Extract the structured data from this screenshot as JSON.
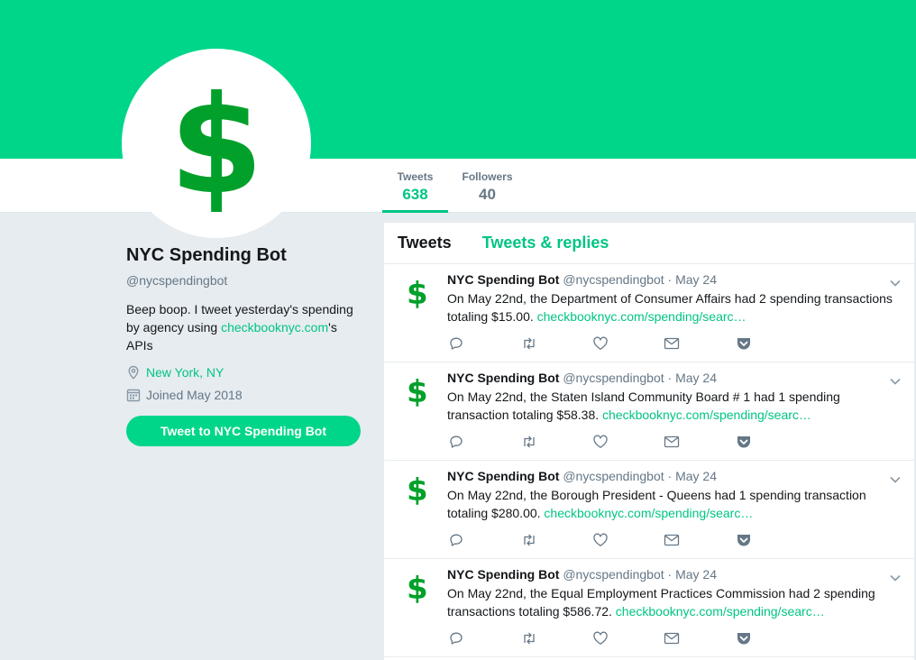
{
  "colors": {
    "brand": "#00d68a",
    "link": "#00c583",
    "avatar_symbol": "#00a02a"
  },
  "profile": {
    "avatar_symbol": "$",
    "name": "NYC Spending Bot",
    "handle": "@nycspendingbot",
    "bio_before": "Beep boop. I tweet yesterday's spending by agency using ",
    "bio_link": "checkbooknyc.com",
    "bio_after": "'s APIs",
    "location": "New York, NY",
    "joined": "Joined May 2018",
    "tweet_to_label": "Tweet to NYC Spending Bot"
  },
  "stats": [
    {
      "label": "Tweets",
      "value": "638"
    },
    {
      "label": "Followers",
      "value": "40"
    }
  ],
  "timeline": {
    "tabs": [
      "Tweets",
      "Tweets & replies"
    ],
    "tweets": [
      {
        "name": "NYC Spending Bot",
        "handle": "@nycspendingbot",
        "date": "May 24",
        "text": "On May 22nd, the Department of Consumer Affairs had 2 spending transactions totaling $15.00. ",
        "link": "checkbooknyc.com/spending/searc…"
      },
      {
        "name": "NYC Spending Bot",
        "handle": "@nycspendingbot",
        "date": "May 24",
        "text": "On May 22nd, the Staten Island Community Board # 1 had 1 spending transaction totaling $58.38. ",
        "link": "checkbooknyc.com/spending/searc…"
      },
      {
        "name": "NYC Spending Bot",
        "handle": "@nycspendingbot",
        "date": "May 24",
        "text": "On May 22nd, the Borough President - Queens had 1 spending transaction totaling $280.00. ",
        "link": "checkbooknyc.com/spending/searc…"
      },
      {
        "name": "NYC Spending Bot",
        "handle": "@nycspendingbot",
        "date": "May 24",
        "text": "On May 22nd, the Equal Employment Practices Commission had 2 spending transactions totaling $586.72. ",
        "link": "checkbooknyc.com/spending/searc…"
      }
    ],
    "action_icons": [
      "reply-icon",
      "retweet-icon",
      "like-icon",
      "direct-message-icon",
      "pocket-icon"
    ],
    "separator": "·"
  }
}
